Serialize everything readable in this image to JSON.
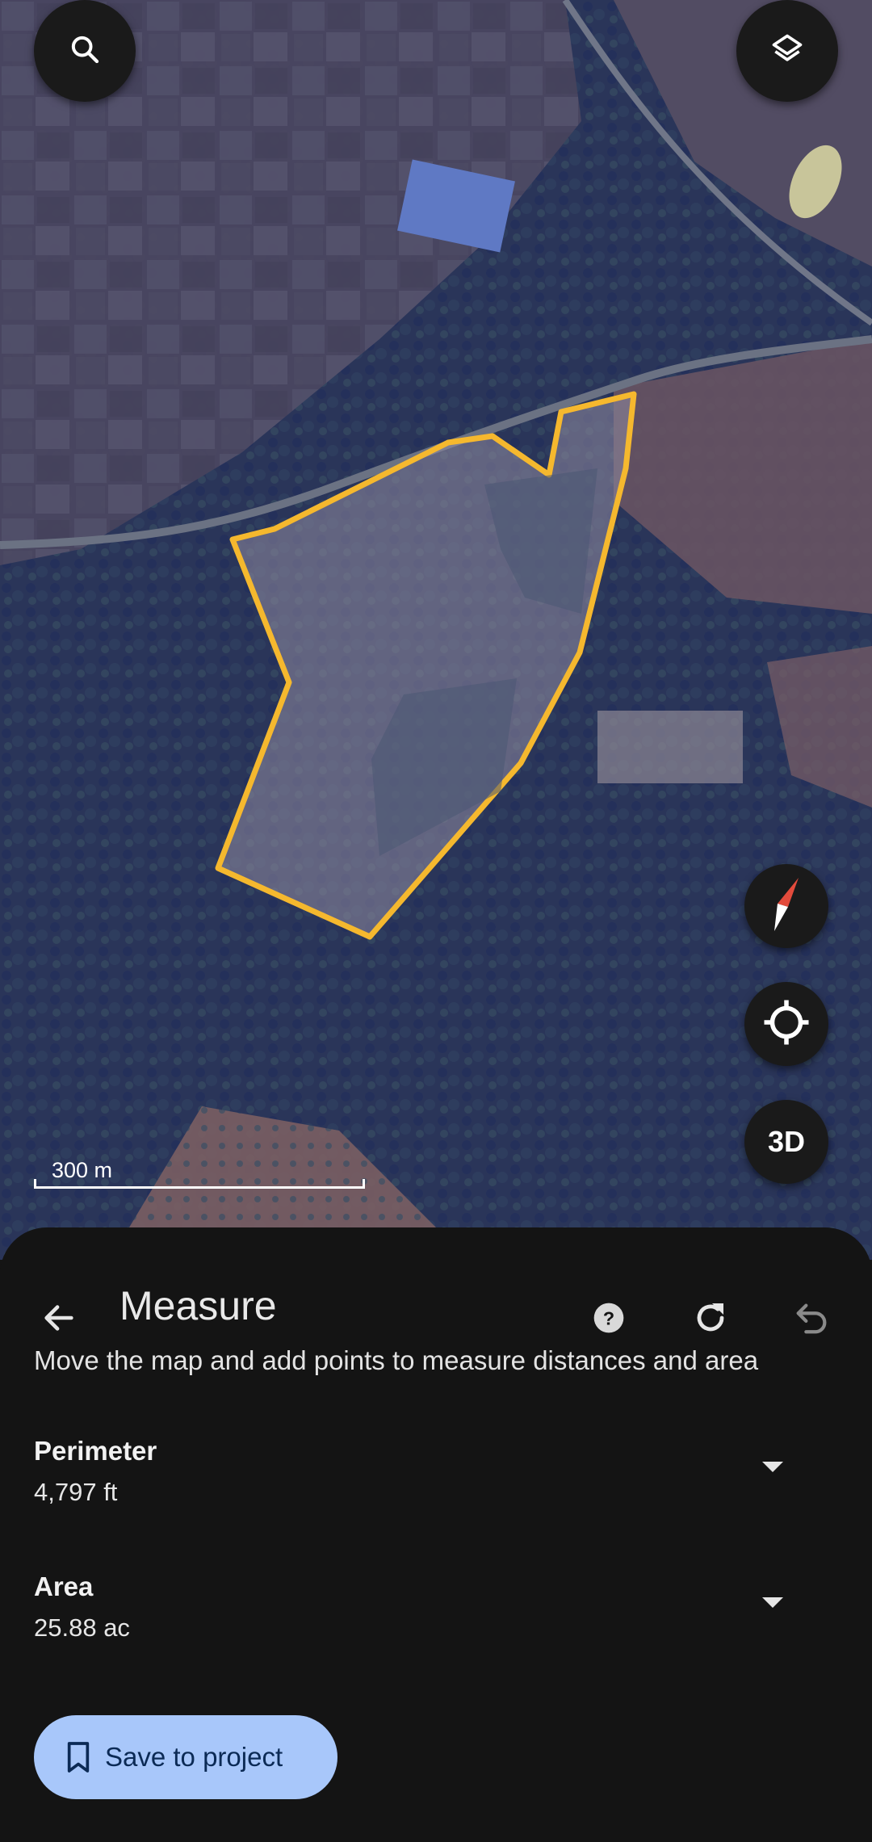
{
  "map": {
    "scale_label": "300 m",
    "toggle_3d_label": "3D",
    "polygon_color": "#f5b82e",
    "icons": [
      "search-icon",
      "layers-icon",
      "compass-icon",
      "my-location-icon"
    ]
  },
  "measure": {
    "title": "Measure",
    "instructions": "Move the map and add points to measure distances and area",
    "perimeter": {
      "label": "Perimeter",
      "value": "4,797 ft"
    },
    "area": {
      "label": "Area",
      "value": "25.88 ac"
    },
    "save_label": "Save to project",
    "icons": [
      "back-arrow-icon",
      "help-icon",
      "reset-icon",
      "undo-icon",
      "bookmark-icon",
      "chevron-down-icon"
    ]
  },
  "colors": {
    "sheet_bg": "#141414",
    "save_button_bg": "#a8c7fa",
    "save_button_text": "#0b2a55"
  }
}
